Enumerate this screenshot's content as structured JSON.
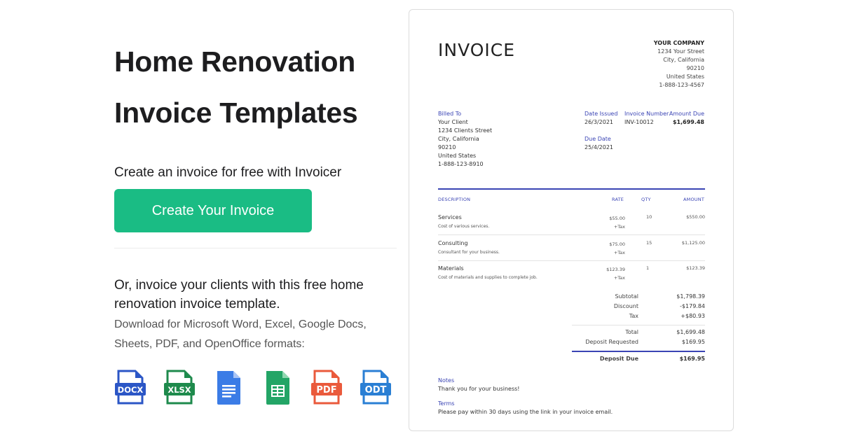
{
  "hero": {
    "title_line1": "Home Renovation",
    "title_line2": "Invoice Templates",
    "cta_lead": "Create an invoice for free with Invoicer",
    "cta_button": "Create Your Invoice",
    "alt_lead": "Or, invoice your clients with this free home renovation invoice template.",
    "alt_sub": "Download for Microsoft Word, Excel, Google Docs, Sheets, PDF, and OpenOffice formats:",
    "accent_color": "#1abc84"
  },
  "formats": [
    {
      "label": "DOCX",
      "icon": "docx-file-icon",
      "color": "#2b56c6"
    },
    {
      "label": "XLSX",
      "icon": "xlsx-file-icon",
      "color": "#1e8a4c"
    },
    {
      "label": "",
      "icon": "google-docs-icon",
      "color": "#3b7ce6"
    },
    {
      "label": "",
      "icon": "google-sheets-icon",
      "color": "#23a566"
    },
    {
      "label": "PDF",
      "icon": "pdf-file-icon",
      "color": "#ea5a3c"
    },
    {
      "label": "ODT",
      "icon": "odt-file-icon",
      "color": "#2a7fd4"
    }
  ],
  "invoice": {
    "title": "INVOICE",
    "accent_color": "#3a44b4",
    "company": {
      "name": "YOUR COMPANY",
      "street": "1234 Your Street",
      "city": "City, California",
      "zip": "90210",
      "country": "United States",
      "phone": "1-888-123-4567"
    },
    "billed_to": {
      "label": "Billed To",
      "name": "Your Client",
      "street": "1234 Clients Street",
      "city": "City, California",
      "zip": "90210",
      "country": "United States",
      "phone": "1-888-123-8910"
    },
    "date_issued": {
      "label": "Date Issued",
      "value": "26/3/2021"
    },
    "invoice_number": {
      "label": "Invoice Number",
      "value": "INV-10012"
    },
    "amount_due": {
      "label": "Amount Due",
      "value": "$1,699.48"
    },
    "due_date": {
      "label": "Due Date",
      "value": "25/4/2021"
    },
    "columns": {
      "description": "DESCRIPTION",
      "rate": "RATE",
      "qty": "QTY",
      "amount": "AMOUNT"
    },
    "items": [
      {
        "name": "Services",
        "desc": "Cost of various services.",
        "rate": "$55.00",
        "tax": "+Tax",
        "qty": "10",
        "amount": "$550.00"
      },
      {
        "name": "Consulting",
        "desc": "Consultant for your business.",
        "rate": "$75.00",
        "tax": "+Tax",
        "qty": "15",
        "amount": "$1,125.00"
      },
      {
        "name": "Materials",
        "desc": "Cost of materials and supplies to complete job.",
        "rate": "$123.39",
        "tax": "+Tax",
        "qty": "1",
        "amount": "$123.39"
      }
    ],
    "totals": {
      "subtotal": {
        "label": "Subtotal",
        "value": "$1,798.39"
      },
      "discount": {
        "label": "Discount",
        "value": "-$179.84"
      },
      "tax": {
        "label": "Tax",
        "value": "+$80.93"
      },
      "total": {
        "label": "Total",
        "value": "$1,699.48"
      },
      "deposit_requested": {
        "label": "Deposit Requested",
        "value": "$169.95"
      },
      "deposit_due": {
        "label": "Deposit Due",
        "value": "$169.95"
      }
    },
    "notes": {
      "label": "Notes",
      "value": "Thank you for your business!"
    },
    "terms": {
      "label": "Terms",
      "value": "Please pay within 30 days using the link in your invoice email."
    }
  }
}
